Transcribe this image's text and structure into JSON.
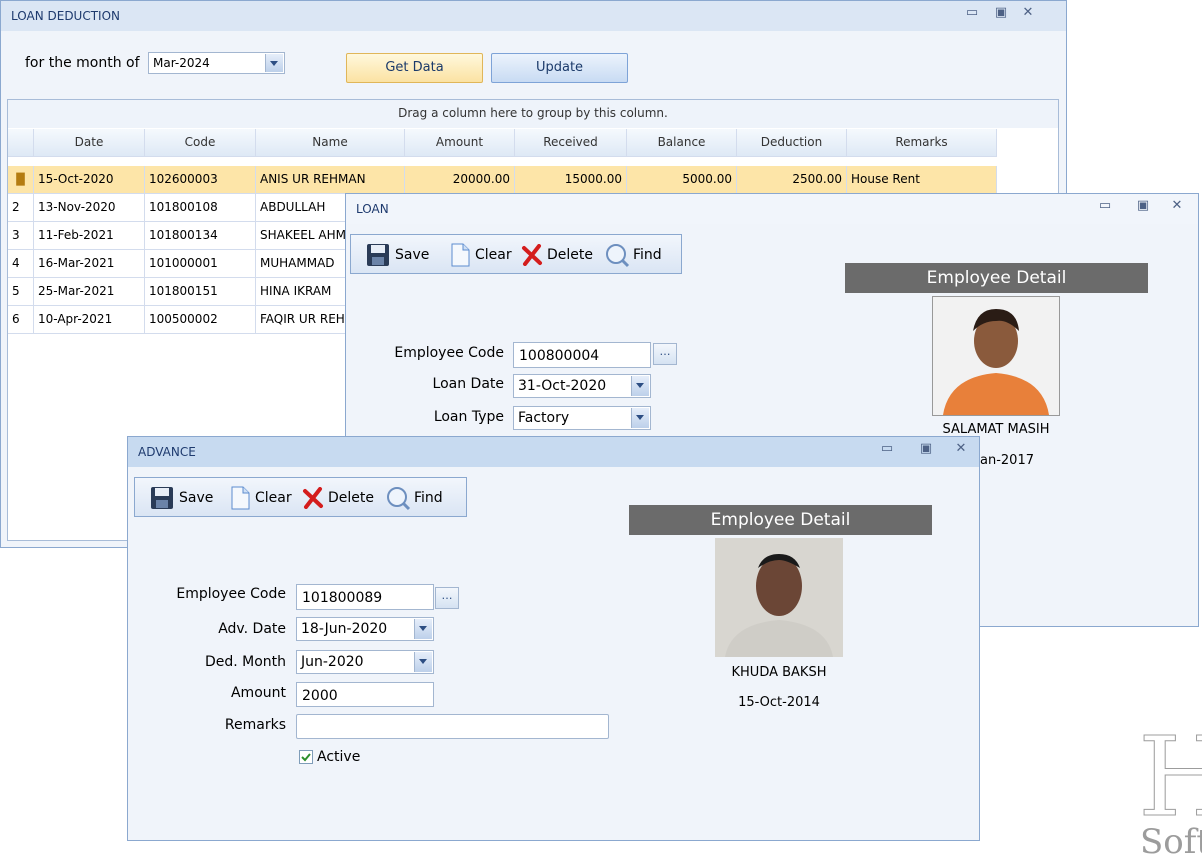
{
  "loan_deduction": {
    "title": "LOAN DEDUCTION",
    "month_label": "for the month of",
    "month_value": "Mar-2024",
    "get_data_label": "Get Data",
    "update_label": "Update",
    "group_hint": "Drag a column here to group by this column.",
    "columns": [
      "Date",
      "Code",
      "Name",
      "Amount",
      "Received",
      "Balance",
      "Deduction",
      "Remarks"
    ],
    "rows": [
      {
        "idx": "",
        "date": "15-Oct-2020",
        "code": "102600003",
        "name": "ANIS UR REHMAN",
        "amount": "20000.00",
        "received": "15000.00",
        "balance": "5000.00",
        "deduction": "2500.00",
        "remarks": "House Rent"
      },
      {
        "idx": "2",
        "date": "13-Nov-2020",
        "code": "101800108",
        "name": "ABDULLAH",
        "amount": "",
        "received": "",
        "balance": "",
        "deduction": "",
        "remarks": ""
      },
      {
        "idx": "3",
        "date": "11-Feb-2021",
        "code": "101800134",
        "name": "SHAKEEL AHM",
        "amount": "",
        "received": "",
        "balance": "",
        "deduction": "",
        "remarks": ""
      },
      {
        "idx": "4",
        "date": "16-Mar-2021",
        "code": "101000001",
        "name": "MUHAMMAD",
        "amount": "",
        "received": "",
        "balance": "",
        "deduction": "",
        "remarks": ""
      },
      {
        "idx": "5",
        "date": "25-Mar-2021",
        "code": "101800151",
        "name": "HINA IKRAM",
        "amount": "",
        "received": "",
        "balance": "",
        "deduction": "",
        "remarks": ""
      },
      {
        "idx": "6",
        "date": "10-Apr-2021",
        "code": "100500002",
        "name": "FAQIR UR REH",
        "amount": "",
        "received": "",
        "balance": "",
        "deduction": "",
        "remarks": ""
      }
    ]
  },
  "loan": {
    "title": "LOAN",
    "toolbar": {
      "save": "Save",
      "clear": "Clear",
      "delete": "Delete",
      "find": "Find"
    },
    "employee_code_label": "Employee Code",
    "employee_code": "100800004",
    "loan_date_label": "Loan Date",
    "loan_date": "31-Oct-2020",
    "loan_type_label": "Loan Type",
    "loan_type": "Factory",
    "detail_header": "Employee Detail",
    "employee_name": "SALAMAT MASIH",
    "employee_date_partial": "an-2017"
  },
  "advance": {
    "title": "ADVANCE",
    "toolbar": {
      "save": "Save",
      "clear": "Clear",
      "delete": "Delete",
      "find": "Find"
    },
    "employee_code_label": "Employee Code",
    "employee_code": "101800089",
    "adv_date_label": "Adv. Date",
    "adv_date": "18-Jun-2020",
    "ded_month_label": "Ded. Month",
    "ded_month": "Jun-2020",
    "amount_label": "Amount",
    "amount": "2000",
    "remarks_label": "Remarks",
    "remarks": "",
    "active_label": "Active",
    "active_checked": true,
    "detail_header": "Employee Detail",
    "employee_name": "KHUDA BAKSH",
    "employee_date": "15-Oct-2014"
  },
  "watermark": {
    "letter": "H",
    "text": "Soft"
  },
  "colors": {
    "title_bg": "#dbe6f4",
    "selected_row": "#fde5a8",
    "detail_header_bg": "#6b6b6b",
    "delete_red": "#d41d1d"
  }
}
